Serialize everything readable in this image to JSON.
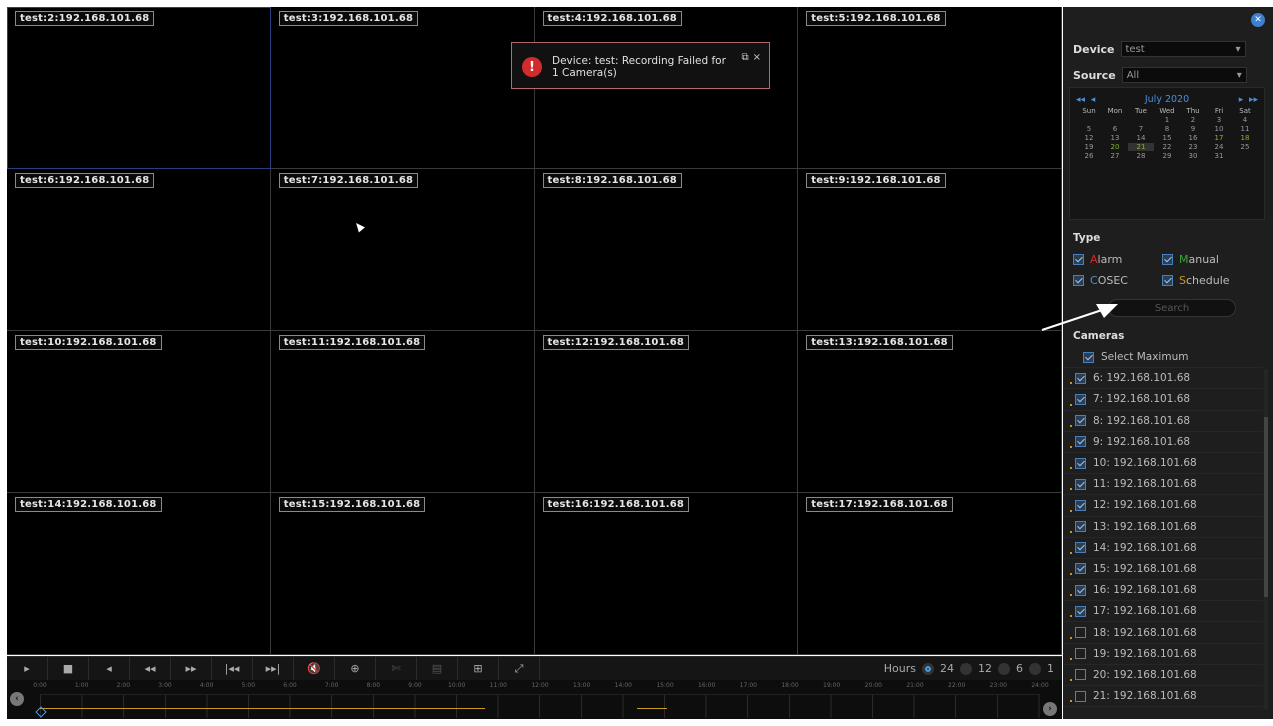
{
  "tiles": [
    "test:2:192.168.101.68",
    "test:3:192.168.101.68",
    "test:4:192.168.101.68",
    "test:5:192.168.101.68",
    "test:6:192.168.101.68",
    "test:7:192.168.101.68",
    "test:8:192.168.101.68",
    "test:9:192.168.101.68",
    "test:10:192.168.101.68",
    "test:11:192.168.101.68",
    "test:12:192.168.101.68",
    "test:13:192.168.101.68",
    "test:14:192.168.101.68",
    "test:15:192.168.101.68",
    "test:16:192.168.101.68",
    "test:17:192.168.101.68"
  ],
  "notification": {
    "line1": "Device: test: Recording Failed for",
    "line2": "1 Camera(s)",
    "icon": "!",
    "restore": "⧉",
    "close": "×"
  },
  "controls": {
    "buttons": [
      "▸",
      "■",
      "◂",
      "◂◂",
      "▸▸",
      "|◂◂",
      "▸▸|",
      "🔇",
      "⊕",
      "✄",
      "▤",
      "⊞",
      "⤢"
    ],
    "hours_label": "Hours",
    "hour_options": [
      "24",
      "12",
      "6",
      "1"
    ],
    "selected_hours": "24"
  },
  "timeline": {
    "ticks": [
      "0:00",
      "1:00",
      "2:00",
      "3:00",
      "4:00",
      "5:00",
      "6:00",
      "7:00",
      "8:00",
      "9:00",
      "10:00",
      "11:00",
      "12:00",
      "13:00",
      "14:00",
      "15:00",
      "16:00",
      "17:00",
      "18:00",
      "19:00",
      "20:00",
      "21:00",
      "22:00",
      "23:00",
      "24:00"
    ],
    "recording_color": "#c79a1a"
  },
  "panel": {
    "device_label": "Device",
    "device_value": "test",
    "source_label": "Source",
    "source_value": "All",
    "calendar": {
      "month": "July 2020",
      "weekdays": [
        "Sun",
        "Mon",
        "Tue",
        "Wed",
        "Thu",
        "Fri",
        "Sat"
      ],
      "weeks": [
        [
          "",
          "",
          "",
          "1",
          "2",
          "3",
          "4"
        ],
        [
          "5",
          "6",
          "7",
          "8",
          "9",
          "10",
          "11"
        ],
        [
          "12",
          "13",
          "14",
          "15",
          "16",
          "17",
          "18"
        ],
        [
          "19",
          "20",
          "21",
          "22",
          "23",
          "24",
          "25"
        ],
        [
          "26",
          "27",
          "28",
          "29",
          "30",
          "31",
          ""
        ]
      ],
      "highlighted": [
        "17",
        "18",
        "20"
      ],
      "selected": "21"
    },
    "type_title": "Type",
    "types": [
      {
        "first": "A",
        "rest": "larm"
      },
      {
        "first": "M",
        "rest": "anual"
      },
      {
        "first": "C",
        "rest": "OSEC"
      },
      {
        "first": "S",
        "rest": "chedule"
      }
    ],
    "search_label": "Search",
    "cameras_title": "Cameras",
    "select_max": "Select Maximum",
    "cameras": [
      {
        "label": "6: 192.168.101.68",
        "checked": true
      },
      {
        "label": "7: 192.168.101.68",
        "checked": true
      },
      {
        "label": "8: 192.168.101.68",
        "checked": true
      },
      {
        "label": "9: 192.168.101.68",
        "checked": true
      },
      {
        "label": "10: 192.168.101.68",
        "checked": true
      },
      {
        "label": "11: 192.168.101.68",
        "checked": true
      },
      {
        "label": "12: 192.168.101.68",
        "checked": true
      },
      {
        "label": "13: 192.168.101.68",
        "checked": true
      },
      {
        "label": "14: 192.168.101.68",
        "checked": true
      },
      {
        "label": "15: 192.168.101.68",
        "checked": true
      },
      {
        "label": "16: 192.168.101.68",
        "checked": true
      },
      {
        "label": "17: 192.168.101.68",
        "checked": true
      },
      {
        "label": "18: 192.168.101.68",
        "checked": false
      },
      {
        "label": "19: 192.168.101.68",
        "checked": false
      },
      {
        "label": "20: 192.168.101.68",
        "checked": false
      },
      {
        "label": "21: 192.168.101.68",
        "checked": false
      }
    ]
  }
}
